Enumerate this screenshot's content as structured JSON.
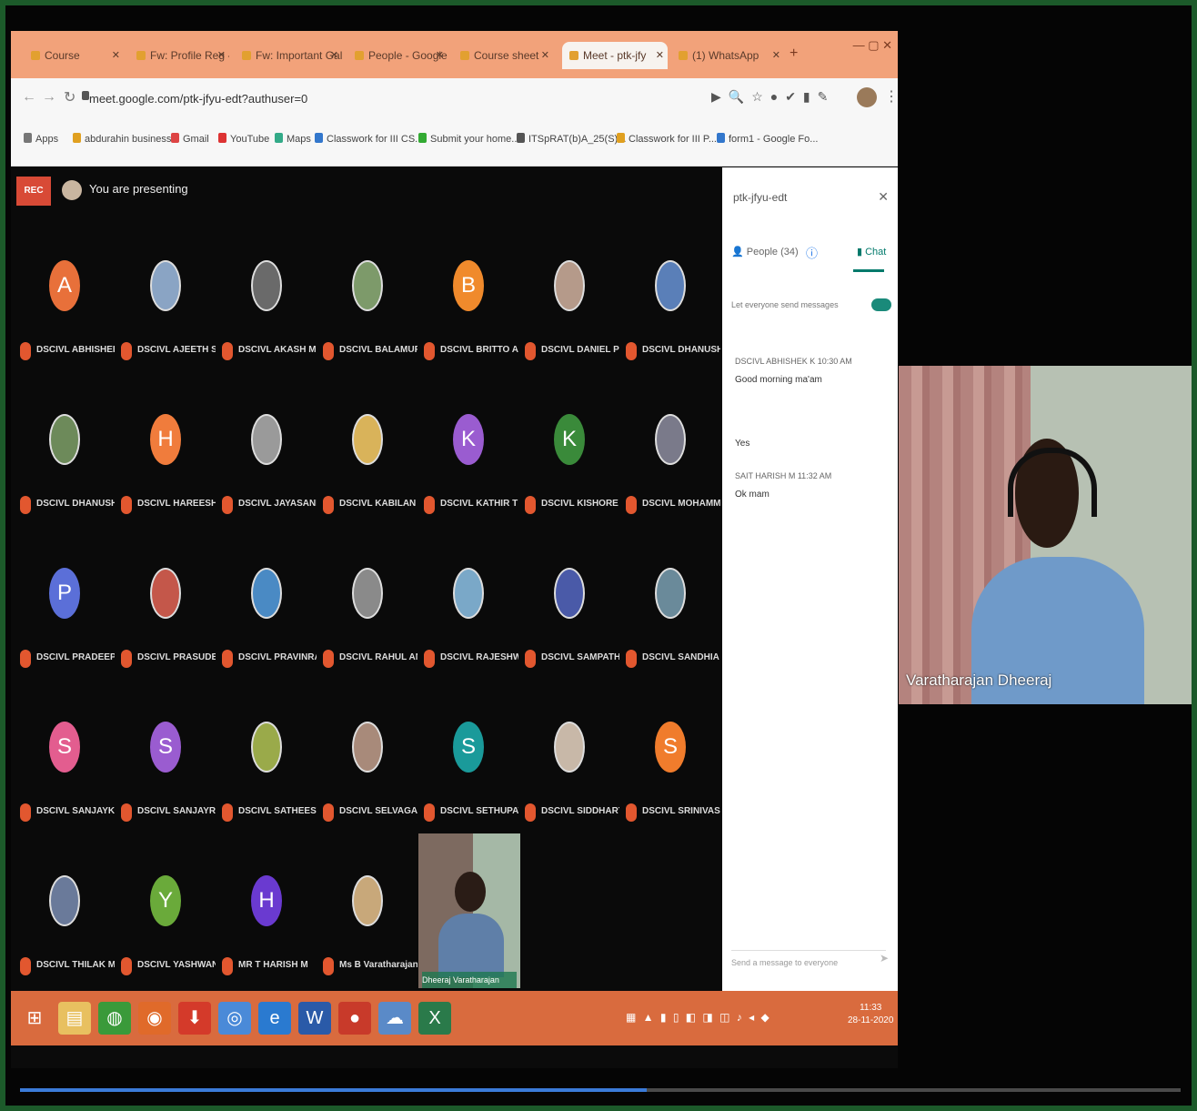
{
  "browser": {
    "tabs": [
      {
        "label": "Course",
        "active": false
      },
      {
        "label": "Fw: Profile Reg - info",
        "active": false
      },
      {
        "label": "Fw: Important Gallery",
        "active": false
      },
      {
        "label": "People - Google F",
        "active": false
      },
      {
        "label": "Course sheet",
        "active": false
      },
      {
        "label": "Meet - ptk-jfy",
        "active": true
      },
      {
        "label": "(1) WhatsApp",
        "active": false
      }
    ],
    "url": "meet.google.com/ptk-jfyu-edt?authuser=0",
    "bookmarks": [
      "Apps",
      "abdurahin business",
      "Gmail",
      "YouTube",
      "Maps",
      "Classwork for III CS...",
      "Submit your home...",
      "ITSpRAT(b)A_25(S)...",
      "Classwork for III P...",
      "form1 - Google Fo..."
    ]
  },
  "meet": {
    "rec_label": "REC",
    "presenting_text": "You are presenting",
    "participants": [
      {
        "initial": "A",
        "color": "#e8703a",
        "name": "DSCIVL ABHISHEK..."
      },
      {
        "initial": "",
        "color": "#8aa4c4",
        "name": "DSCIVL AJEETH S"
      },
      {
        "initial": "",
        "color": "#6a6a6a",
        "name": "DSCIVL AKASH M V"
      },
      {
        "initial": "",
        "color": "#7d9a6a",
        "name": "DSCIVL BALAMURALI M"
      },
      {
        "initial": "B",
        "color": "#f08a2c",
        "name": "DSCIVL BRITTO AG"
      },
      {
        "initial": "",
        "color": "#b59a8a",
        "name": "DSCIVL DANIEL PRAVIN..."
      },
      {
        "initial": "",
        "color": "#5a7fb8",
        "name": "DSCIVL DHANUSHKE..."
      },
      {
        "initial": "",
        "color": "#6d8a5a",
        "name": "DSCIVL DHANUSHRAJ..."
      },
      {
        "initial": "H",
        "color": "#f07c3c",
        "name": "DSCIVL HAREESH R"
      },
      {
        "initial": "",
        "color": "#9a9a9a",
        "name": "DSCIVL JAYASANKER"
      },
      {
        "initial": "",
        "color": "#d9b35a",
        "name": "DSCIVL KABILAN B"
      },
      {
        "initial": "K",
        "color": "#9a5cd0",
        "name": "DSCIVL KATHIR T"
      },
      {
        "initial": "K",
        "color": "#3a8a3a",
        "name": "DSCIVL KISHORE SB"
      },
      {
        "initial": "",
        "color": "#7a7a8a",
        "name": "DSCIVL MOHAMMED A..."
      },
      {
        "initial": "P",
        "color": "#5b6fd8",
        "name": "DSCIVL PRADEEPKUM..."
      },
      {
        "initial": "",
        "color": "#c4574a",
        "name": "DSCIVL PRASUDESWARY"
      },
      {
        "initial": "",
        "color": "#4a8ac4",
        "name": "DSCIVL PRAVINRAJ J"
      },
      {
        "initial": "",
        "color": "#8a8a8a",
        "name": "DSCIVL RAHUL ANAN..."
      },
      {
        "initial": "",
        "color": "#7aa8c8",
        "name": "DSCIVL RAJESHWARI C..."
      },
      {
        "initial": "",
        "color": "#4a5aa8",
        "name": "DSCIVL SAMPATH RAJ F"
      },
      {
        "initial": "",
        "color": "#6a8a9a",
        "name": "DSCIVL SANDHIA"
      },
      {
        "initial": "S",
        "color": "#e35d8f",
        "name": "DSCIVL SANJAYKUMA..."
      },
      {
        "initial": "S",
        "color": "#9a5cd0",
        "name": "DSCIVL SANJAYRAM R"
      },
      {
        "initial": "",
        "color": "#9aaa4a",
        "name": "DSCIVL SATHEESWA..."
      },
      {
        "initial": "",
        "color": "#a88a7a",
        "name": "DSCIVL SELVAGANESH..."
      },
      {
        "initial": "S",
        "color": "#1a9a9a",
        "name": "DSCIVL SETHUPATHI S..."
      },
      {
        "initial": "",
        "color": "#c8b8a8",
        "name": "DSCIVL SIDDHARTH"
      },
      {
        "initial": "S",
        "color": "#f07c2c",
        "name": "DSCIVL SRINIVASARAJ P"
      },
      {
        "initial": "",
        "color": "#6a7a9a",
        "name": "DSCIVL THILAK M"
      },
      {
        "initial": "Y",
        "color": "#6aaa3a",
        "name": "DSCIVL YASHWANTH..."
      },
      {
        "initial": "H",
        "color": "#6a3ad0",
        "name": "MR T HARISH M"
      },
      {
        "initial": "",
        "color": "#c8a87a",
        "name": "Ms B Varatharajan HODCT..."
      }
    ],
    "self_tile_label": "Dheeraj Varatharajan"
  },
  "chat": {
    "meeting_details": "ptk-jfyu-edt",
    "people_tab": "People (34)",
    "chat_tab": "Chat",
    "toggle_label": "Let everyone send messages",
    "messages": [
      {
        "sender": "DSCIVL ABHISHEK K  10:30 AM",
        "text": "Good morning ma'am"
      },
      {
        "sender": "",
        "text": "Yes"
      },
      {
        "sender": "SAIT HARISH M  11:32 AM",
        "text": "Ok mam"
      }
    ],
    "input_placeholder": "Send a message to everyone"
  },
  "taskbar": {
    "icons": [
      "windows-start",
      "file-explorer",
      "quickbooks",
      "firefox",
      "downloader",
      "chrome",
      "internet-explorer",
      "word",
      "recorder",
      "network",
      "excel"
    ],
    "clock_time": "11:33",
    "clock_date": "28-11-2020"
  },
  "webcam": {
    "name": "Varatharajan Dheeraj"
  },
  "player": {
    "progress_fraction": 0.54
  }
}
